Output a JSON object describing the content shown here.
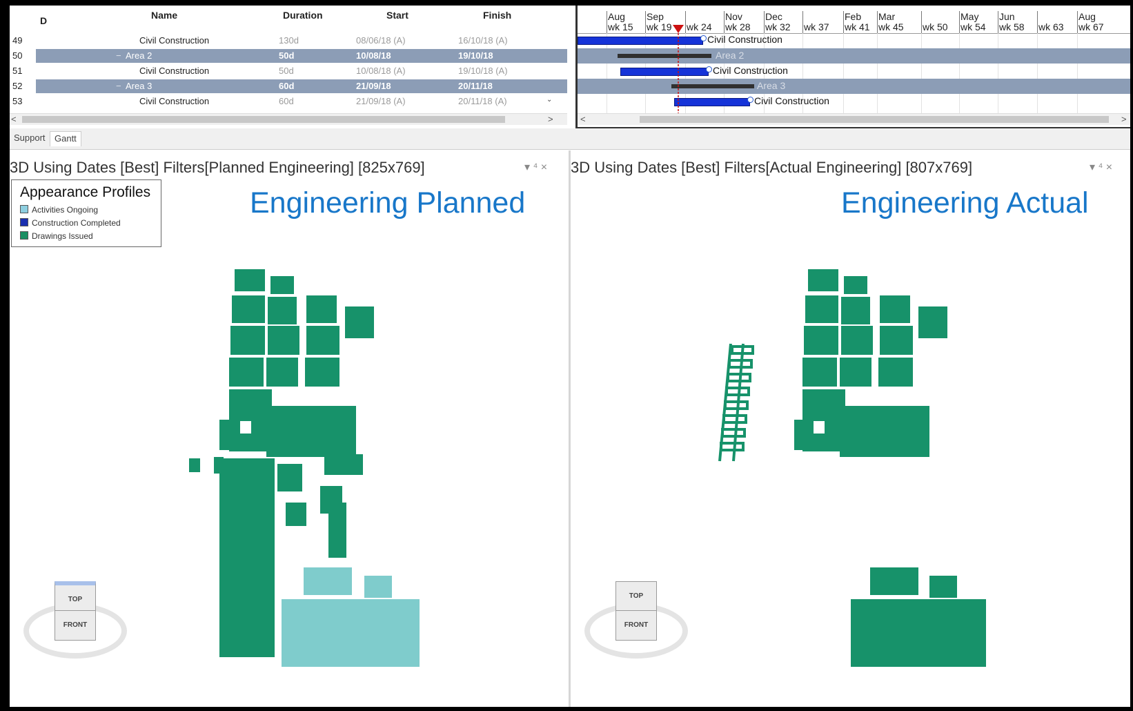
{
  "task_table": {
    "columns": {
      "id": "D",
      "name": "Name",
      "duration": "Duration",
      "start": "Start",
      "finish": "Finish"
    },
    "rows": [
      {
        "id": "49",
        "name": "Civil Construction",
        "duration": "130d",
        "start": "08/06/18 (A)",
        "finish": "16/10/18 (A)",
        "summary": false
      },
      {
        "id": "50",
        "name": "Area 2",
        "duration": "50d",
        "start": "10/08/18",
        "finish": "19/10/18",
        "summary": true
      },
      {
        "id": "51",
        "name": "Civil Construction",
        "duration": "50d",
        "start": "10/08/18 (A)",
        "finish": "19/10/18 (A)",
        "summary": false
      },
      {
        "id": "52",
        "name": "Area 3",
        "duration": "60d",
        "start": "21/09/18",
        "finish": "20/11/18",
        "summary": true
      },
      {
        "id": "53",
        "name": "Civil Construction",
        "duration": "60d",
        "start": "21/09/18 (A)",
        "finish": "20/11/18 (A)",
        "summary": false
      }
    ]
  },
  "gantt": {
    "months": [
      "Aug",
      "Sep",
      "Nov",
      "Dec",
      "Feb",
      "Mar",
      "May",
      "Jun",
      "Aug"
    ],
    "weeks": [
      "wk 15",
      "wk 19",
      "wk 24",
      "wk 28",
      "wk 32",
      "wk 37",
      "wk 41",
      "wk 45",
      "wk 50",
      "wk 54",
      "wk 58",
      "wk 63",
      "wk 67"
    ],
    "bars": [
      "Civil Construction",
      "Area 2",
      "Civil Construction",
      "Area 3",
      "Civil Construction"
    ]
  },
  "tabs": [
    "Support",
    "Gantt"
  ],
  "view_left": {
    "title": "3D Using Dates [Best] Filters[Planned Engineering] [825x769]",
    "overlay": "Engineering Planned",
    "controls": "▾ ⁴ ×"
  },
  "view_right": {
    "title": "3D Using Dates [Best] Filters[Actual Engineering] [807x769]",
    "overlay": "Engineering Actual",
    "controls": "▾ ⁴ ×"
  },
  "legend": {
    "title": "Appearance Profiles",
    "items": [
      {
        "label": "Activities Ongoing",
        "color": "#8ecfe0"
      },
      {
        "label": "Construction Completed",
        "color": "#1a2fb0"
      },
      {
        "label": "Drawings Issued",
        "color": "#1b8f63"
      }
    ]
  },
  "navcube": {
    "top": "TOP",
    "front": "FRONT"
  },
  "colors": {
    "structure": "#17926a",
    "ongoing": "#7fcccc",
    "summary_row": "#8c9db6",
    "gantt_bar": "#1533d8"
  }
}
